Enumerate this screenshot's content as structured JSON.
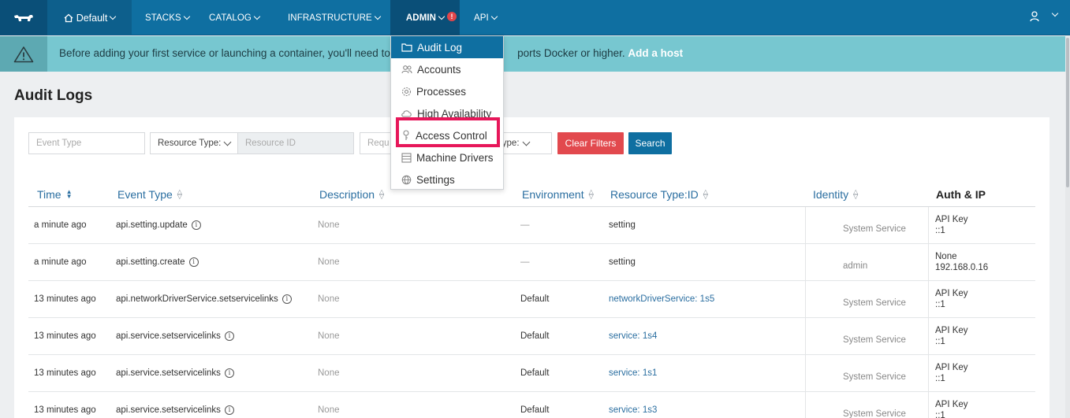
{
  "nav": {
    "environment": "Default",
    "items": [
      {
        "label": "STACKS"
      },
      {
        "label": "CATALOG"
      },
      {
        "label": "INFRASTRUCTURE"
      },
      {
        "label": "ADMIN"
      },
      {
        "label": "API"
      }
    ],
    "admin_alert": "!"
  },
  "banner": {
    "text": "Before adding your first service or launching a container, you'll need to a",
    "text_tail": "ports Docker or higher.",
    "link": "Add a host"
  },
  "page": {
    "title": "Audit Logs"
  },
  "filters": {
    "event_type_placeholder": "Event Type",
    "resource_type_label": "Resource Type:",
    "resource_id_placeholder": "Resource ID",
    "request_placeholder": "Requ",
    "auth_type_label": "h Type:",
    "clear_label": "Clear Filters",
    "search_label": "Search"
  },
  "table": {
    "columns": [
      "Time",
      "Event Type",
      "Description",
      "Environment",
      "Resource Type:ID",
      "Identity",
      "Auth & IP"
    ],
    "rows": [
      {
        "time": "a minute ago",
        "event": "api.setting.update",
        "desc": "None",
        "env": "—",
        "resource": "setting",
        "identity": "System Service",
        "auth": "API Key",
        "ip": "::1"
      },
      {
        "time": "a minute ago",
        "event": "api.setting.create",
        "desc": "None",
        "env": "—",
        "resource": "setting",
        "identity": "admin",
        "auth": "None",
        "ip": "192.168.0.16"
      },
      {
        "time": "13 minutes ago",
        "event": "api.networkDriverService.setservicelinks",
        "desc": "None",
        "env": "Default",
        "resource": "networkDriverService: 1s5",
        "identity": "System Service",
        "auth": "API Key",
        "ip": "::1"
      },
      {
        "time": "13 minutes ago",
        "event": "api.service.setservicelinks",
        "desc": "None",
        "env": "Default",
        "resource": "service: 1s4",
        "identity": "System Service",
        "auth": "API Key",
        "ip": "::1"
      },
      {
        "time": "13 minutes ago",
        "event": "api.service.setservicelinks",
        "desc": "None",
        "env": "Default",
        "resource": "service: 1s1",
        "identity": "System Service",
        "auth": "API Key",
        "ip": "::1"
      },
      {
        "time": "13 minutes ago",
        "event": "api.service.setservicelinks",
        "desc": "None",
        "env": "Default",
        "resource": "service: 1s3",
        "identity": "System Service",
        "auth": "API Key",
        "ip": "::1"
      }
    ]
  },
  "admin_menu": {
    "items": [
      {
        "label": "Audit Log",
        "icon": "folder-icon"
      },
      {
        "label": "Accounts",
        "icon": "users-icon"
      },
      {
        "label": "Processes",
        "icon": "gear-icon"
      },
      {
        "label": "High Availability",
        "icon": "cloud-icon"
      },
      {
        "label": "Access Control",
        "icon": "key-icon"
      },
      {
        "label": "Machine Drivers",
        "icon": "server-icon"
      },
      {
        "label": "Settings",
        "icon": "globe-icon"
      }
    ],
    "selected": "Audit Log"
  },
  "colors": {
    "nav": "#0f6fa1",
    "banner": "#77c7d0",
    "danger": "#e2494e",
    "highlight": "#e7175a"
  }
}
